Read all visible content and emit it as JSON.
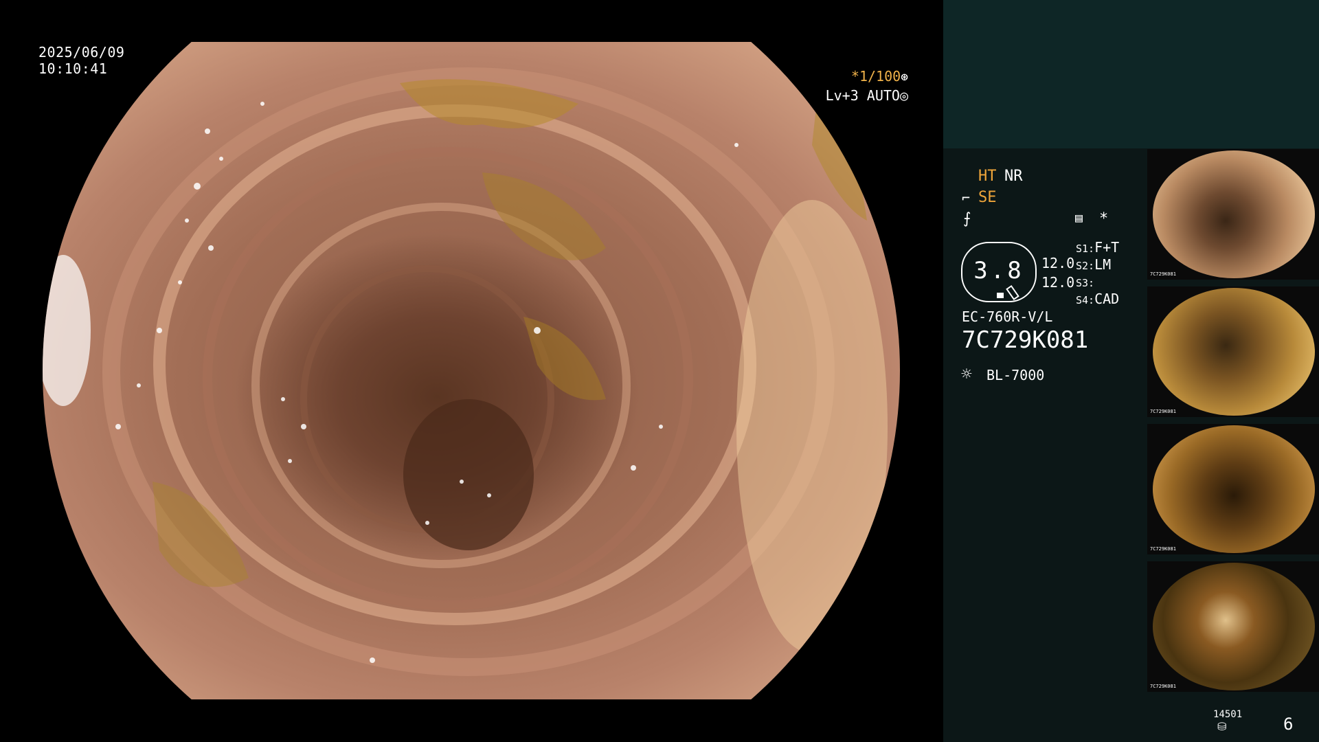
{
  "overlay": {
    "date": "2025/06/09",
    "time": "10:10:41",
    "shutter": "*1/100",
    "shutter_icon": "⊛",
    "iris_mode": "Lv+3 AUTO",
    "iris_icon": "◎"
  },
  "panel": {
    "mode_ht": "HT",
    "mode_nr": "NR",
    "mode_se": "SE",
    "se_icon": "⌐",
    "f_icon": "⨍",
    "list_icon": "▤",
    "star_icon": "*",
    "gauge_value": "3.8",
    "gauge_right_1": "12.0",
    "gauge_right_2": "12.0",
    "switches": [
      {
        "key": "S1:",
        "value": "F+T"
      },
      {
        "key": "S2:",
        "value": "LM"
      },
      {
        "key": "S3:",
        "value": ""
      },
      {
        "key": "S4:",
        "value": "CAD"
      }
    ],
    "scope_model": "EC-760R-V/L",
    "scope_serial": "7C729K081",
    "light_icon": "☼",
    "light_source": "BL-7000",
    "counter_small": "14501",
    "disk_icon": "⛁",
    "counter_big": "6"
  },
  "thumbnails": [
    {
      "caption": "7C729K081"
    },
    {
      "caption": "7C729K081"
    },
    {
      "caption": "7C729K081"
    },
    {
      "caption": "7C729K081"
    }
  ],
  "colors": {
    "accent_orange": "#f0a63a",
    "panel_bg": "#0c1717",
    "panel_top_bg": "#0e2626"
  }
}
